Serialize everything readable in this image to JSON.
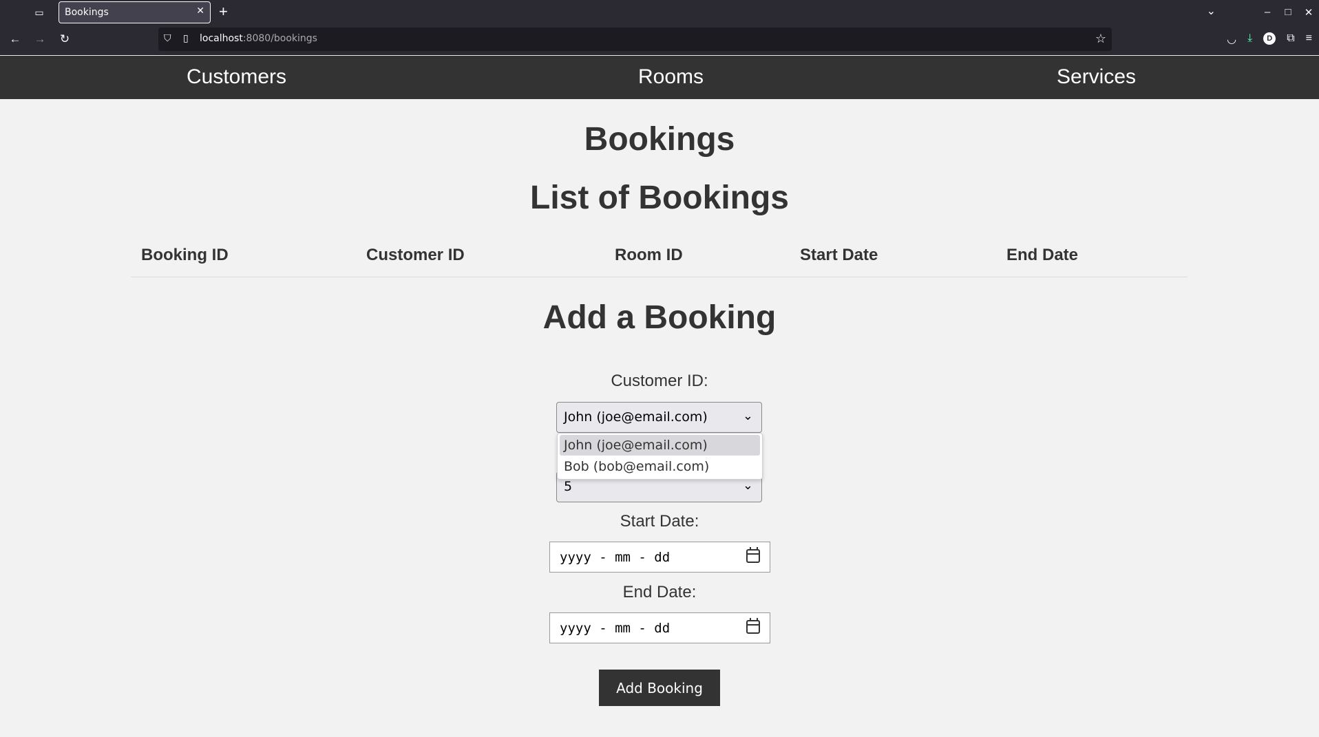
{
  "browser": {
    "tab_title": "Bookings",
    "url_host": "localhost",
    "url_rest": ":8080/bookings"
  },
  "site_nav": {
    "customers": "Customers",
    "rooms": "Rooms",
    "services": "Services"
  },
  "page": {
    "title": "Bookings",
    "list_title": "List of Bookings",
    "table_headers": [
      "Booking ID",
      "Customer ID",
      "Room ID",
      "Start Date",
      "End Date"
    ],
    "form_title": "Add a Booking"
  },
  "form": {
    "customer_label": "Customer ID:",
    "customer_selected": "John (joe@email.com)",
    "customer_options": [
      "John (joe@email.com)",
      "Bob (bob@email.com)"
    ],
    "room_selected": "5",
    "start_label": "Start Date:",
    "start_placeholder": "yyyy - mm - dd",
    "end_label": "End Date:",
    "end_placeholder": "yyyy - mm - dd",
    "submit_label": "Add Booking"
  }
}
